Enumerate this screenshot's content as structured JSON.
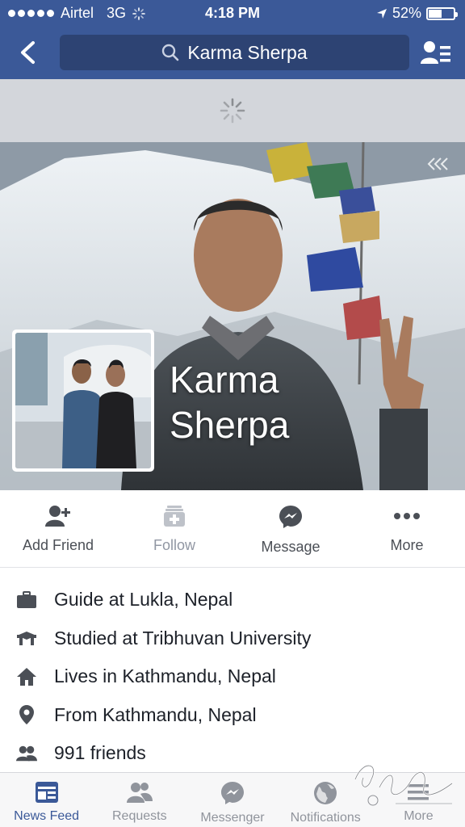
{
  "status_bar": {
    "carrier": "Airtel",
    "network": "3G",
    "time": "4:18 PM",
    "battery": "52%",
    "battery_level": 0.52
  },
  "nav": {
    "search_text": "Karma Sherpa"
  },
  "profile": {
    "name_line1": "Karma",
    "name_line2": "Sherpa"
  },
  "actions": [
    {
      "label": "Add Friend",
      "icon": "add-friend-icon",
      "enabled": true
    },
    {
      "label": "Follow",
      "icon": "follow-icon",
      "enabled": false
    },
    {
      "label": "Message",
      "icon": "messenger-icon",
      "enabled": true
    },
    {
      "label": "More",
      "icon": "more-dots-icon",
      "enabled": true
    }
  ],
  "info": [
    {
      "text": "Guide at Lukla, Nepal",
      "icon": "briefcase-icon"
    },
    {
      "text": "Studied at Tribhuvan University",
      "icon": "graduation-cap-icon"
    },
    {
      "text": "Lives in Kathmandu, Nepal",
      "icon": "house-icon"
    },
    {
      "text": "From Kathmandu, Nepal",
      "icon": "location-pin-icon"
    },
    {
      "text": "991 friends",
      "icon": "friends-icon"
    }
  ],
  "tabs": [
    {
      "label": "News Feed",
      "icon": "news-feed-icon",
      "active": true
    },
    {
      "label": "Requests",
      "icon": "requests-icon",
      "active": false
    },
    {
      "label": "Messenger",
      "icon": "messenger-icon",
      "active": false
    },
    {
      "label": "Notifications",
      "icon": "globe-icon",
      "active": false
    },
    {
      "label": "More",
      "icon": "menu-icon",
      "active": false
    }
  ],
  "colors": {
    "brand": "#3b5998",
    "search_bg": "#2d4373",
    "active_tab": "#3b5998",
    "inactive": "#90949c"
  }
}
